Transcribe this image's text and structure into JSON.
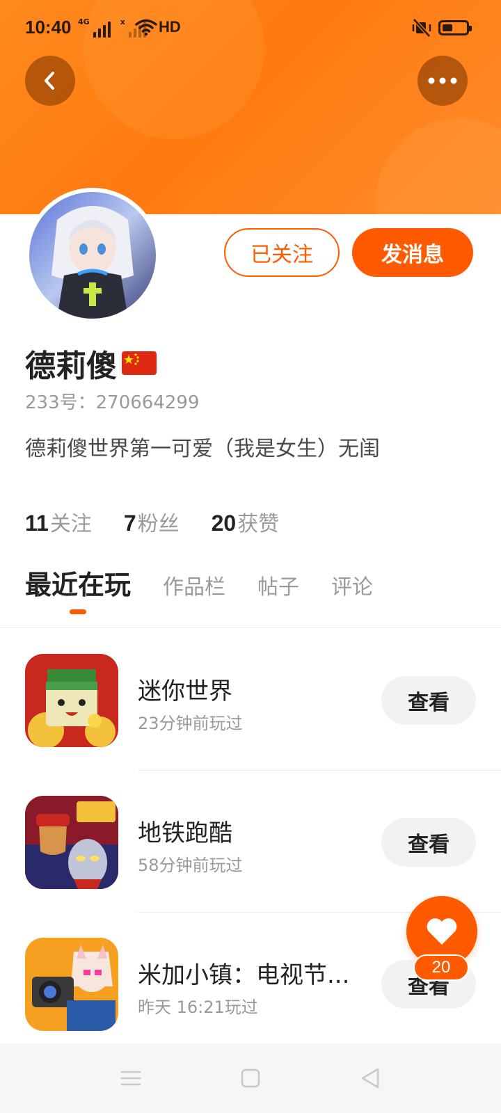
{
  "status_bar": {
    "time": "10:40",
    "network_label": "4G",
    "network2_label": "x",
    "hd_label": "HD",
    "battery_level": 0.45
  },
  "profile": {
    "name": "德莉傻",
    "id_text": "233号：270664299",
    "bio": "德莉傻世界第一可爱（我是女生）无闺",
    "follow_label": "已关注",
    "message_label": "发消息",
    "stats": [
      {
        "value": "11",
        "label": "关注"
      },
      {
        "value": "7",
        "label": "粉丝"
      },
      {
        "value": "20",
        "label": "获赞"
      }
    ]
  },
  "tabs": [
    {
      "label": "最近在玩",
      "active": true
    },
    {
      "label": "作品栏",
      "active": false
    },
    {
      "label": "帖子",
      "active": false
    },
    {
      "label": "评论",
      "active": false
    }
  ],
  "games": [
    {
      "title": "迷你世界",
      "subtitle": "23分钟前玩过",
      "action": "查看"
    },
    {
      "title": "地铁跑酷",
      "subtitle": "58分钟前玩过",
      "action": "查看"
    },
    {
      "title": "米加小镇：电视节...",
      "subtitle": "昨天 16:21玩过",
      "action": "查看"
    }
  ],
  "like_fab": {
    "count": "20"
  },
  "colors": {
    "accent": "#ff5a00",
    "header": "#ff7a10"
  }
}
